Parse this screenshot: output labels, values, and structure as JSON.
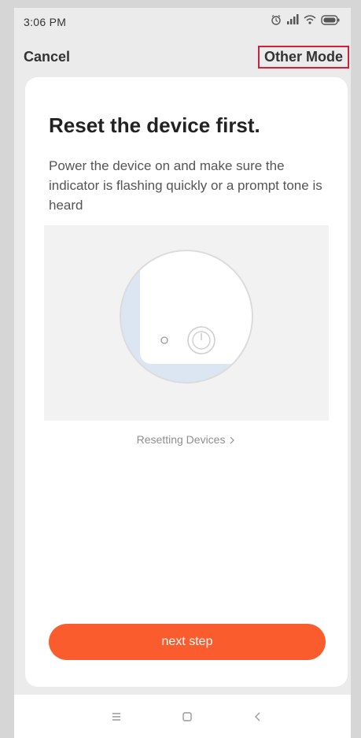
{
  "status_bar": {
    "time": "3:06 PM",
    "icons": [
      "alarm-icon",
      "signal-icon",
      "wifi-icon",
      "battery-icon"
    ]
  },
  "nav": {
    "cancel_label": "Cancel",
    "other_mode_label": "Other Mode"
  },
  "card": {
    "title": "Reset the device first.",
    "description": "Power the device on and make sure the indicator is flashing quickly or a prompt tone is heard",
    "illustration_icon": "device-power-illustration",
    "reset_link_label": "Resetting Devices",
    "reset_link_icon": "chevron-right-icon",
    "next_button_label": "next step"
  },
  "bottom_nav": {
    "icons": [
      "menu-icon",
      "home-icon",
      "back-icon"
    ]
  },
  "colors": {
    "accent": "#fa5c2e",
    "highlight_border": "#d1203a"
  }
}
